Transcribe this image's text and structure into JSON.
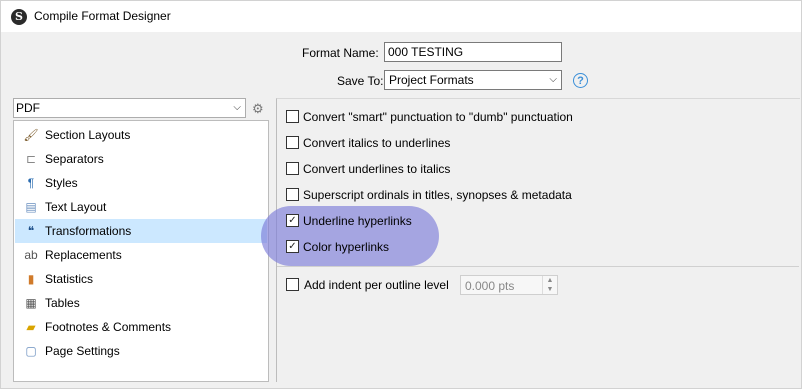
{
  "window": {
    "title": "Compile Format Designer",
    "app_icon_glyph": "S"
  },
  "format": {
    "name_label": "Format Name:",
    "name_value": "000 TESTING",
    "save_to_label": "Save To:",
    "save_to_value": "Project Formats",
    "help_glyph": "?"
  },
  "output_format": {
    "value": "PDF"
  },
  "sidebar": {
    "selected_index": 4,
    "items": [
      {
        "label": "Section Layouts",
        "icon": "brush-icon",
        "glyph": "🖌",
        "color": "#7a5a2a"
      },
      {
        "label": "Separators",
        "icon": "separator-icon",
        "glyph": "⊏",
        "color": "#888888"
      },
      {
        "label": "Styles",
        "icon": "styles-icon",
        "glyph": "¶",
        "color": "#2b6cb0"
      },
      {
        "label": "Text Layout",
        "icon": "text-layout-icon",
        "glyph": "▤",
        "color": "#6a8fbf"
      },
      {
        "label": "Transformations",
        "icon": "transformations-icon",
        "glyph": "❝",
        "color": "#1d4f8a"
      },
      {
        "label": "Replacements",
        "icon": "replacements-icon",
        "glyph": "ab",
        "color": "#555555"
      },
      {
        "label": "Statistics",
        "icon": "statistics-icon",
        "glyph": "▮",
        "color": "#d07a2a"
      },
      {
        "label": "Tables",
        "icon": "tables-icon",
        "glyph": "▦",
        "color": "#555555"
      },
      {
        "label": "Footnotes & Comments",
        "icon": "footnotes-icon",
        "glyph": "▰",
        "color": "#d9a400"
      },
      {
        "label": "Page Settings",
        "icon": "page-settings-icon",
        "glyph": "▢",
        "color": "#6a8fbf"
      }
    ]
  },
  "options": [
    {
      "label": "Convert \"smart\" punctuation to \"dumb\" punctuation",
      "checked": false
    },
    {
      "label": "Convert italics to underlines",
      "checked": false
    },
    {
      "label": "Convert underlines to italics",
      "checked": false
    },
    {
      "label": "Superscript ordinals in titles, synopses & metadata",
      "checked": false
    },
    {
      "label": "Underline hyperlinks",
      "checked": true
    },
    {
      "label": "Color hyperlinks",
      "checked": true
    }
  ],
  "indent": {
    "label": "Add indent per outline level",
    "checked": false,
    "value": "0.000 pts"
  },
  "colors": {
    "selection": "#cce8ff",
    "highlight": "#7d7dd8",
    "help_accent": "#3a8fd8"
  }
}
